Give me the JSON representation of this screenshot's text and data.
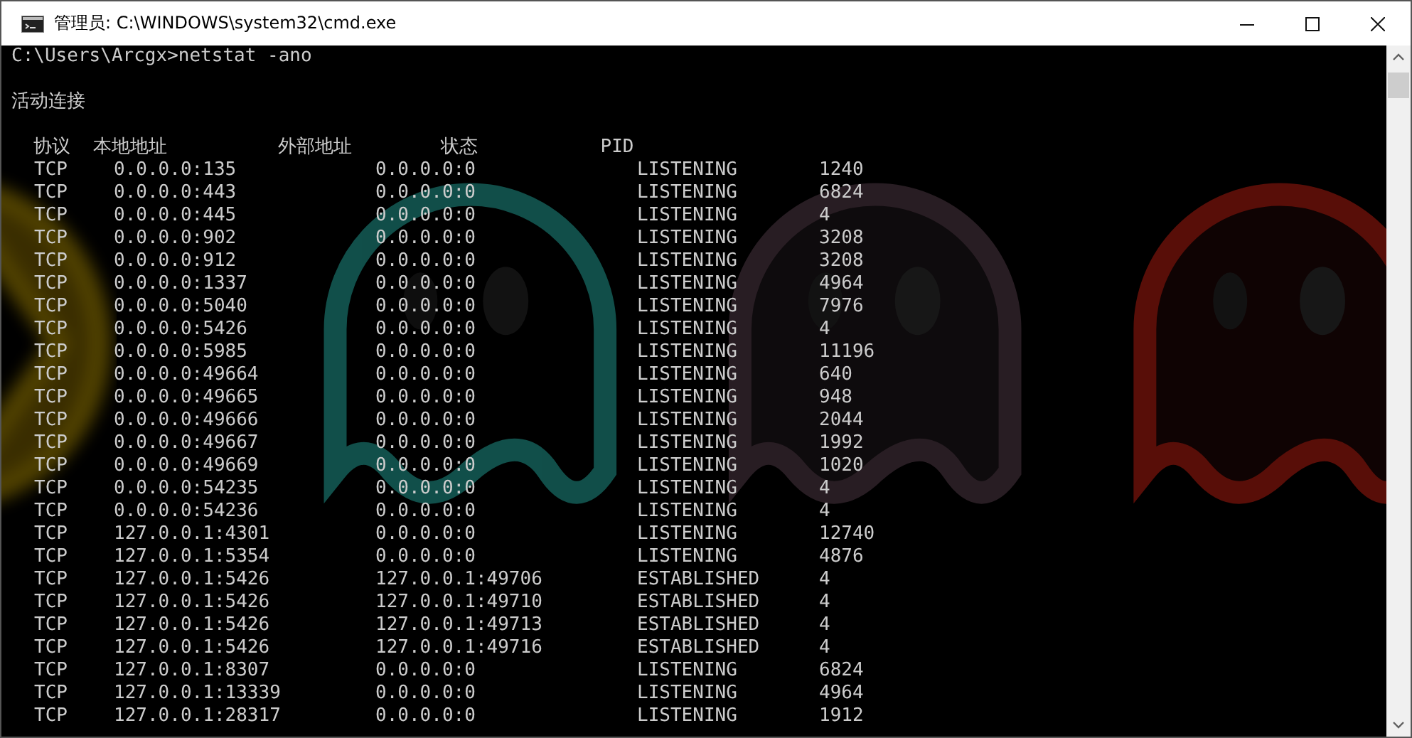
{
  "window": {
    "title": "管理员: C:\\WINDOWS\\system32\\cmd.exe"
  },
  "console": {
    "command_line": "C:\\Users\\Arcgx>netstat -ano",
    "section_title": "活动连接",
    "header_line": "  协议  本地地址          外部地址        状态           PID",
    "table": {
      "rows": [
        [
          "TCP",
          "0.0.0.0:135",
          "0.0.0.0:0",
          "LISTENING",
          "1240"
        ],
        [
          "TCP",
          "0.0.0.0:443",
          "0.0.0.0:0",
          "LISTENING",
          "6824"
        ],
        [
          "TCP",
          "0.0.0.0:445",
          "0.0.0.0:0",
          "LISTENING",
          "4"
        ],
        [
          "TCP",
          "0.0.0.0:902",
          "0.0.0.0:0",
          "LISTENING",
          "3208"
        ],
        [
          "TCP",
          "0.0.0.0:912",
          "0.0.0.0:0",
          "LISTENING",
          "3208"
        ],
        [
          "TCP",
          "0.0.0.0:1337",
          "0.0.0.0:0",
          "LISTENING",
          "4964"
        ],
        [
          "TCP",
          "0.0.0.0:5040",
          "0.0.0.0:0",
          "LISTENING",
          "7976"
        ],
        [
          "TCP",
          "0.0.0.0:5426",
          "0.0.0.0:0",
          "LISTENING",
          "4"
        ],
        [
          "TCP",
          "0.0.0.0:5985",
          "0.0.0.0:0",
          "LISTENING",
          "11196"
        ],
        [
          "TCP",
          "0.0.0.0:49664",
          "0.0.0.0:0",
          "LISTENING",
          "640"
        ],
        [
          "TCP",
          "0.0.0.0:49665",
          "0.0.0.0:0",
          "LISTENING",
          "948"
        ],
        [
          "TCP",
          "0.0.0.0:49666",
          "0.0.0.0:0",
          "LISTENING",
          "2044"
        ],
        [
          "TCP",
          "0.0.0.0:49667",
          "0.0.0.0:0",
          "LISTENING",
          "1992"
        ],
        [
          "TCP",
          "0.0.0.0:49669",
          "0.0.0.0:0",
          "LISTENING",
          "1020"
        ],
        [
          "TCP",
          "0.0.0.0:54235",
          "0.0.0.0:0",
          "LISTENING",
          "4"
        ],
        [
          "TCP",
          "0.0.0.0:54236",
          "0.0.0.0:0",
          "LISTENING",
          "4"
        ],
        [
          "TCP",
          "127.0.0.1:4301",
          "0.0.0.0:0",
          "LISTENING",
          "12740"
        ],
        [
          "TCP",
          "127.0.0.1:5354",
          "0.0.0.0:0",
          "LISTENING",
          "4876"
        ],
        [
          "TCP",
          "127.0.0.1:5426",
          "127.0.0.1:49706",
          "ESTABLISHED",
          "4"
        ],
        [
          "TCP",
          "127.0.0.1:5426",
          "127.0.0.1:49710",
          "ESTABLISHED",
          "4"
        ],
        [
          "TCP",
          "127.0.0.1:5426",
          "127.0.0.1:49713",
          "ESTABLISHED",
          "4"
        ],
        [
          "TCP",
          "127.0.0.1:5426",
          "127.0.0.1:49716",
          "ESTABLISHED",
          "4"
        ],
        [
          "TCP",
          "127.0.0.1:8307",
          "0.0.0.0:0",
          "LISTENING",
          "6824"
        ],
        [
          "TCP",
          "127.0.0.1:13339",
          "0.0.0.0:0",
          "LISTENING",
          "4964"
        ],
        [
          "TCP",
          "127.0.0.1:28317",
          "0.0.0.0:0",
          "LISTENING",
          "1912"
        ]
      ]
    }
  }
}
